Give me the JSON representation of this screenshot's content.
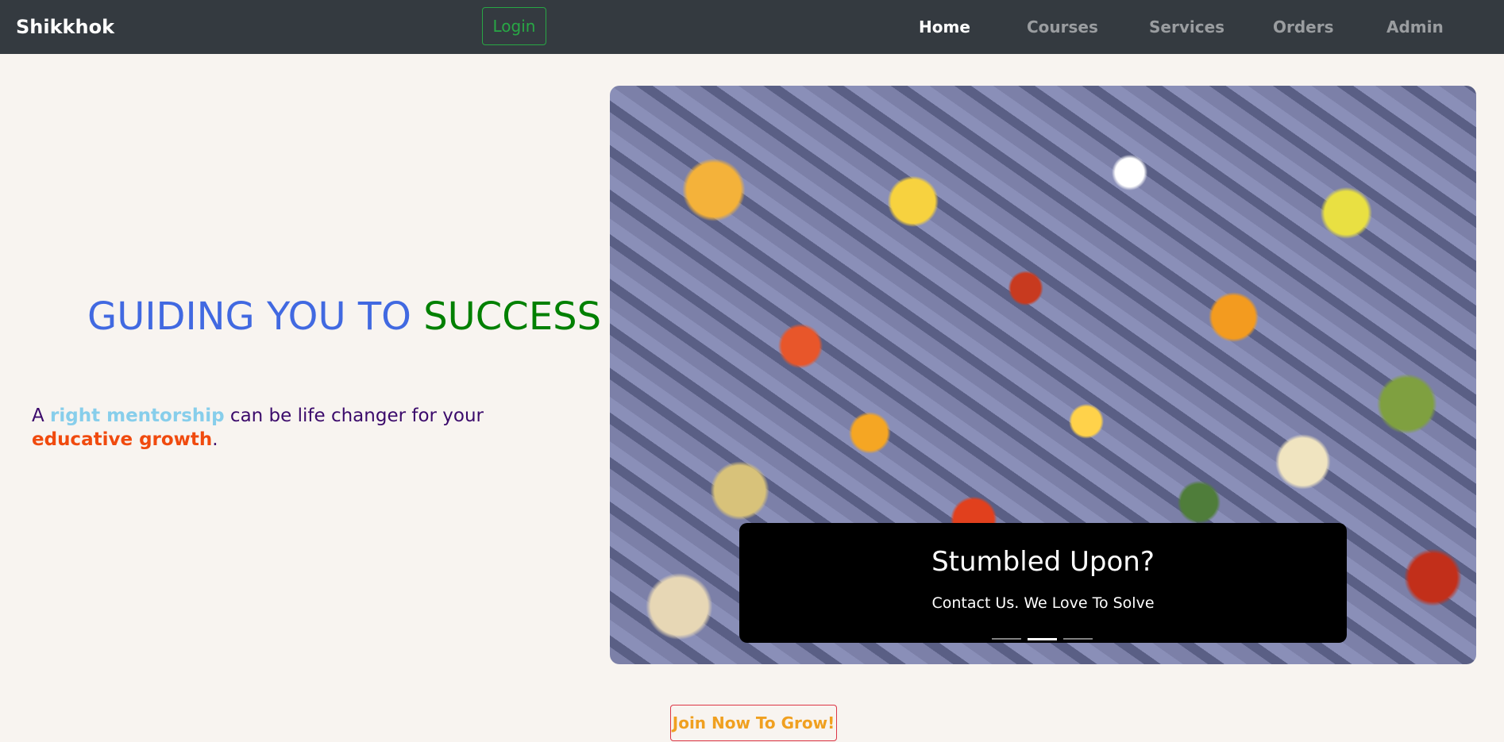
{
  "navbar": {
    "brand": "Shikkhok",
    "login_label": "Login",
    "links": [
      {
        "label": "Home",
        "active": true
      },
      {
        "label": "Courses",
        "active": false
      },
      {
        "label": "Services",
        "active": false
      },
      {
        "label": "Orders",
        "active": false
      },
      {
        "label": "Admin",
        "active": false
      }
    ]
  },
  "hero": {
    "title_part1": "GUIDING YOU TO ",
    "title_part2": "SUCCESS",
    "subtitle": {
      "part1": "A ",
      "highlight1": "right mentorship",
      "part2": " can be life changer for your ",
      "highlight2": "educative growth",
      "part3": "."
    }
  },
  "carousel": {
    "image_icon": "jigsaw-puzzle-pieces-image",
    "caption_title": "Stumbled Upon?",
    "caption_text": "Contact Us. We Love To Solve",
    "indicator_count": 3,
    "active_indicator": 1
  },
  "cta": {
    "label": "Join Now To Grow!"
  },
  "colors": {
    "navbar_bg": "#343a40",
    "page_bg": "#f8f4f0",
    "title_blue": "#4169e1",
    "title_green": "#008000",
    "login_green": "#28a745",
    "cta_border": "#dc3545",
    "cta_text": "#f0a020"
  }
}
